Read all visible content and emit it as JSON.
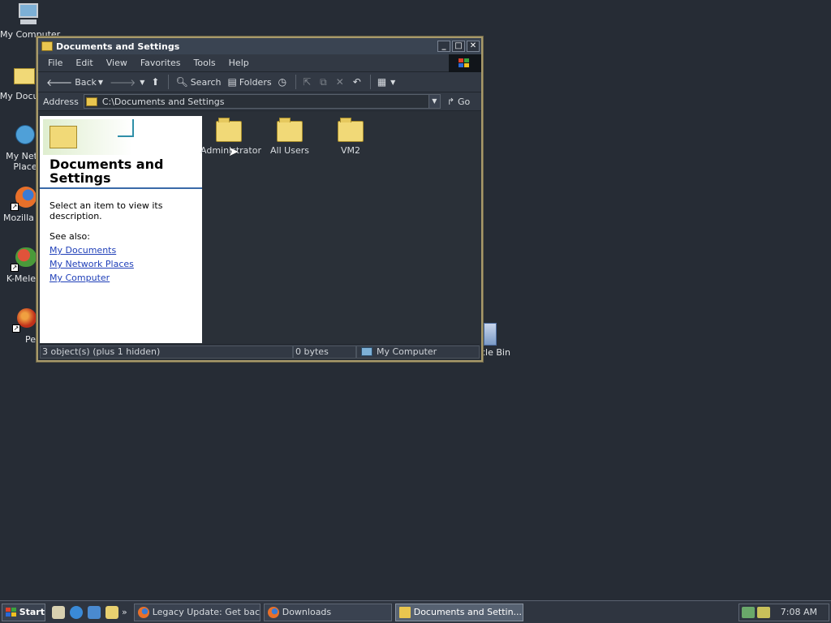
{
  "desktop": {
    "icons": [
      {
        "label": "My Computer"
      },
      {
        "label": "My Docum"
      },
      {
        "label": "My Netw Place"
      },
      {
        "label": "Mozilla Fi"
      },
      {
        "label": "K-Melec"
      },
      {
        "label": "Peg"
      }
    ],
    "recycle_bin_label": "cle Bin"
  },
  "window": {
    "title": "Documents and Settings",
    "controls": {
      "minimize": "_",
      "maximize": "□",
      "close": "✕"
    },
    "menu": [
      "File",
      "Edit",
      "View",
      "Favorites",
      "Tools",
      "Help"
    ],
    "toolbar": {
      "back": "Back",
      "search": "Search",
      "folders": "Folders"
    },
    "address": {
      "label": "Address",
      "value": "C:\\Documents and Settings",
      "go": "Go"
    },
    "task_pane": {
      "title": "Documents and Settings",
      "description": "Select an item to view its description.",
      "see_also_label": "See also:",
      "links": [
        "My Documents",
        "My Network Places",
        "My Computer"
      ]
    },
    "items": [
      {
        "name": "Administrator"
      },
      {
        "name": "All Users"
      },
      {
        "name": "VM2"
      }
    ],
    "status": {
      "objects": "3 object(s) (plus 1 hidden)",
      "size": "0 bytes",
      "zone": "My Computer"
    }
  },
  "taskbar": {
    "start_label": "Start",
    "quicklaunch_more": "»",
    "tasks": [
      {
        "label": "Legacy Update: Get back ..."
      },
      {
        "label": "Downloads"
      },
      {
        "label": "Documents and Settin..."
      }
    ],
    "clock": "7:08 AM"
  }
}
